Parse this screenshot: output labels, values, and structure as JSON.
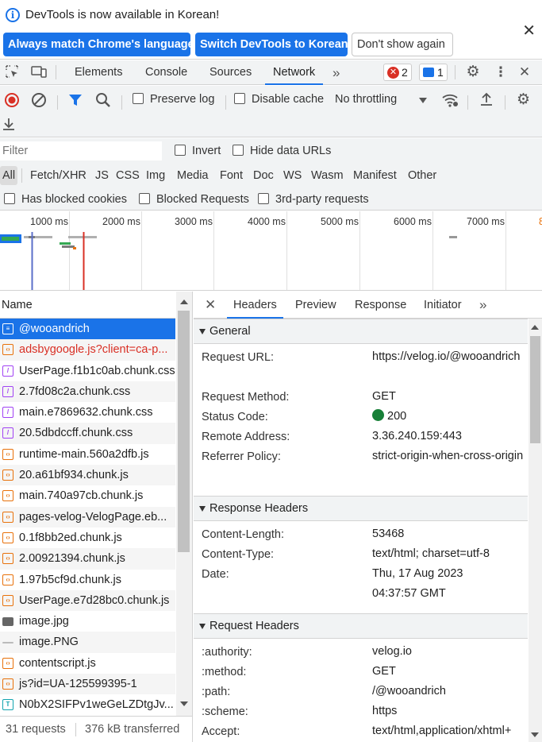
{
  "infobar": {
    "message": "DevTools is now available in Korean!",
    "btn_match": "Always match Chrome's language",
    "btn_switch": "Switch DevTools to Korean",
    "btn_dont_show": "Don't show again"
  },
  "tabs": [
    "Elements",
    "Console",
    "Sources",
    "Network"
  ],
  "active_tab": "Network",
  "badges": {
    "errors": "2",
    "messages": "1"
  },
  "toolbar": {
    "preserve_log": "Preserve log",
    "disable_cache": "Disable cache",
    "throttling": "No throttling"
  },
  "filter": {
    "placeholder": "Filter",
    "invert": "Invert",
    "hide_data_urls": "Hide data URLs"
  },
  "types": [
    "All",
    "Fetch/XHR",
    "JS",
    "CSS",
    "Img",
    "Media",
    "Font",
    "Doc",
    "WS",
    "Wasm",
    "Manifest",
    "Other"
  ],
  "blocked": {
    "has_blocked_cookies": "Has blocked cookies",
    "blocked_requests": "Blocked Requests",
    "third_party": "3rd-party requests"
  },
  "overview": {
    "labels": [
      "1000 ms",
      "2000 ms",
      "3000 ms",
      "4000 ms",
      "5000 ms",
      "6000 ms",
      "7000 ms"
    ]
  },
  "requests": {
    "header": "Name",
    "items": [
      {
        "name": "@wooandrich",
        "type": "doc"
      },
      {
        "name": "adsbygoogle.js?client=ca-p...",
        "type": "js",
        "error": true
      },
      {
        "name": "UserPage.f1b1c0ab.chunk.css",
        "type": "css"
      },
      {
        "name": "2.7fd08c2a.chunk.css",
        "type": "css"
      },
      {
        "name": "main.e7869632.chunk.css",
        "type": "css"
      },
      {
        "name": "20.5dbdccff.chunk.css",
        "type": "css"
      },
      {
        "name": "runtime-main.560a2dfb.js",
        "type": "js"
      },
      {
        "name": "20.a61bf934.chunk.js",
        "type": "js"
      },
      {
        "name": "main.740a97cb.chunk.js",
        "type": "js"
      },
      {
        "name": "pages-velog-VelogPage.eb...",
        "type": "js"
      },
      {
        "name": "0.1f8bb2ed.chunk.js",
        "type": "js"
      },
      {
        "name": "2.00921394.chunk.js",
        "type": "js"
      },
      {
        "name": "1.97b5cf9d.chunk.js",
        "type": "js"
      },
      {
        "name": "UserPage.e7d28bc0.chunk.js",
        "type": "js"
      },
      {
        "name": "image.jpg",
        "type": "img"
      },
      {
        "name": "image.PNG",
        "type": "ping"
      },
      {
        "name": "contentscript.js",
        "type": "js"
      },
      {
        "name": "js?id=UA-125599395-1",
        "type": "js"
      },
      {
        "name": "N0bX2SIFPv1weGeLZDtgJv...",
        "type": "font"
      }
    ],
    "summary_requests": "31 requests",
    "summary_transferred": "376 kB transferred"
  },
  "detail_tabs": [
    "Headers",
    "Preview",
    "Response",
    "Initiator"
  ],
  "general": {
    "title": "General",
    "request_url_key": "Request URL:",
    "request_url_val": "https://velog.io/@wooandrich",
    "method_key": "Request Method:",
    "method_val": "GET",
    "status_key": "Status Code:",
    "status_val": "200",
    "remote_key": "Remote Address:",
    "remote_val": "3.36.240.159:443",
    "referrer_key": "Referrer Policy:",
    "referrer_val": "strict-origin-when-cross-origin"
  },
  "response_headers": {
    "title": "Response Headers",
    "cl_key": "Content-Length:",
    "cl_val": "53468",
    "ct_key": "Content-Type:",
    "ct_val": "text/html; charset=utf-8",
    "date_key": "Date:",
    "date_val": "Thu, 17 Aug 2023 04:37:57 GMT"
  },
  "request_headers": {
    "title": "Request Headers",
    "authority_key": ":authority:",
    "authority_val": "velog.io",
    "method_key": ":method:",
    "method_val": "GET",
    "path_key": ":path:",
    "path_val": "/@wooandrich",
    "scheme_key": ":scheme:",
    "scheme_val": "https",
    "accept_key": "Accept:",
    "accept_val": "text/html,application/xhtml+"
  }
}
